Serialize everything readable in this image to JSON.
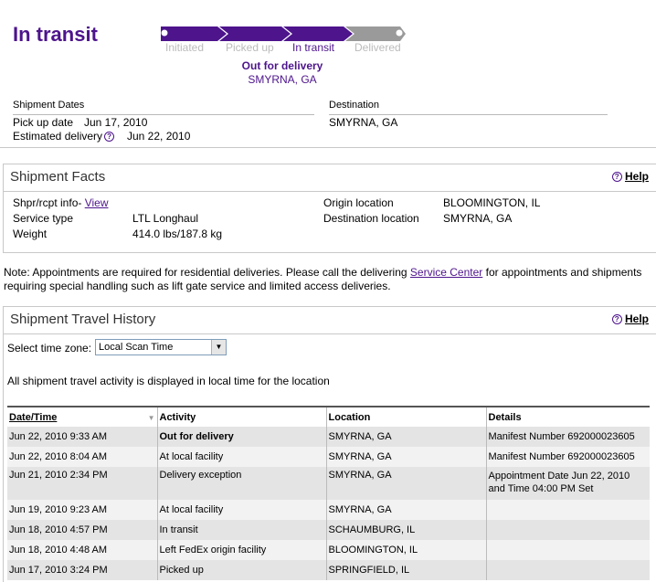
{
  "status": {
    "title": "In transit",
    "stages": [
      "Initiated",
      "Picked up",
      "In transit",
      "Delivered"
    ],
    "current_stage": 3,
    "status_line": "Out for delivery",
    "status_location": "SMYRNA, GA",
    "accent_color": "#4d148c"
  },
  "dates": {
    "heading": "Shipment Dates",
    "pickup_label": "Pick up date",
    "pickup_value": "Jun 17, 2010",
    "estimated_label": "Estimated delivery",
    "estimated_value": "Jun 22, 2010"
  },
  "destination": {
    "heading": "Destination",
    "value": "SMYRNA, GA"
  },
  "facts": {
    "title": "Shipment Facts",
    "help": "Help",
    "shipper_label": "Shpr/rcpt info-",
    "shipper_link": "View",
    "service_label": "Service type",
    "service_value": "LTL Longhaul",
    "weight_label": "Weight",
    "weight_value": "414.0 lbs/187.8 kg",
    "origin_label": "Origin location",
    "origin_value": "BLOOMINGTON, IL",
    "dest_label": "Destination location",
    "dest_value": "SMYRNA, GA"
  },
  "note": {
    "before": "Note: Appointments are required for residential deliveries. Please call the delivering ",
    "link": "Service Center",
    "after": " for appointments and shipments requiring special handling such as lift gate service and limited access deliveries."
  },
  "history": {
    "title": "Shipment Travel History",
    "help": "Help",
    "tz_label": "Select time zone:",
    "tz_value": "Local Scan Time",
    "info": "All shipment travel activity is displayed in local time for the location",
    "columns": [
      "Date/Time",
      "Activity",
      "Location",
      "Details"
    ],
    "rows": [
      {
        "date": "Jun 22, 2010 9:33 AM",
        "activity": "Out for delivery",
        "location": "SMYRNA, GA",
        "details": "Manifest Number 692000023605"
      },
      {
        "date": "Jun 22, 2010 8:04 AM",
        "activity": "At local facility",
        "location": "SMYRNA, GA",
        "details": "Manifest Number 692000023605"
      },
      {
        "date": "Jun 21, 2010 2:34 PM",
        "activity": "Delivery exception",
        "location": "SMYRNA, GA",
        "details": "Appointment Date Jun 22, 2010 and Time 04:00 PM Set"
      },
      {
        "date": "Jun 19, 2010 9:23 AM",
        "activity": "At local facility",
        "location": "SMYRNA, GA",
        "details": ""
      },
      {
        "date": "Jun 18, 2010 4:57 PM",
        "activity": "In transit",
        "location": "SCHAUMBURG, IL",
        "details": ""
      },
      {
        "date": "Jun 18, 2010 4:48 AM",
        "activity": "Left FedEx origin facility",
        "location": "BLOOMINGTON, IL",
        "details": ""
      },
      {
        "date": "Jun 17, 2010 3:24 PM",
        "activity": "Picked up",
        "location": "SPRINGFIELD, IL",
        "details": ""
      }
    ]
  }
}
